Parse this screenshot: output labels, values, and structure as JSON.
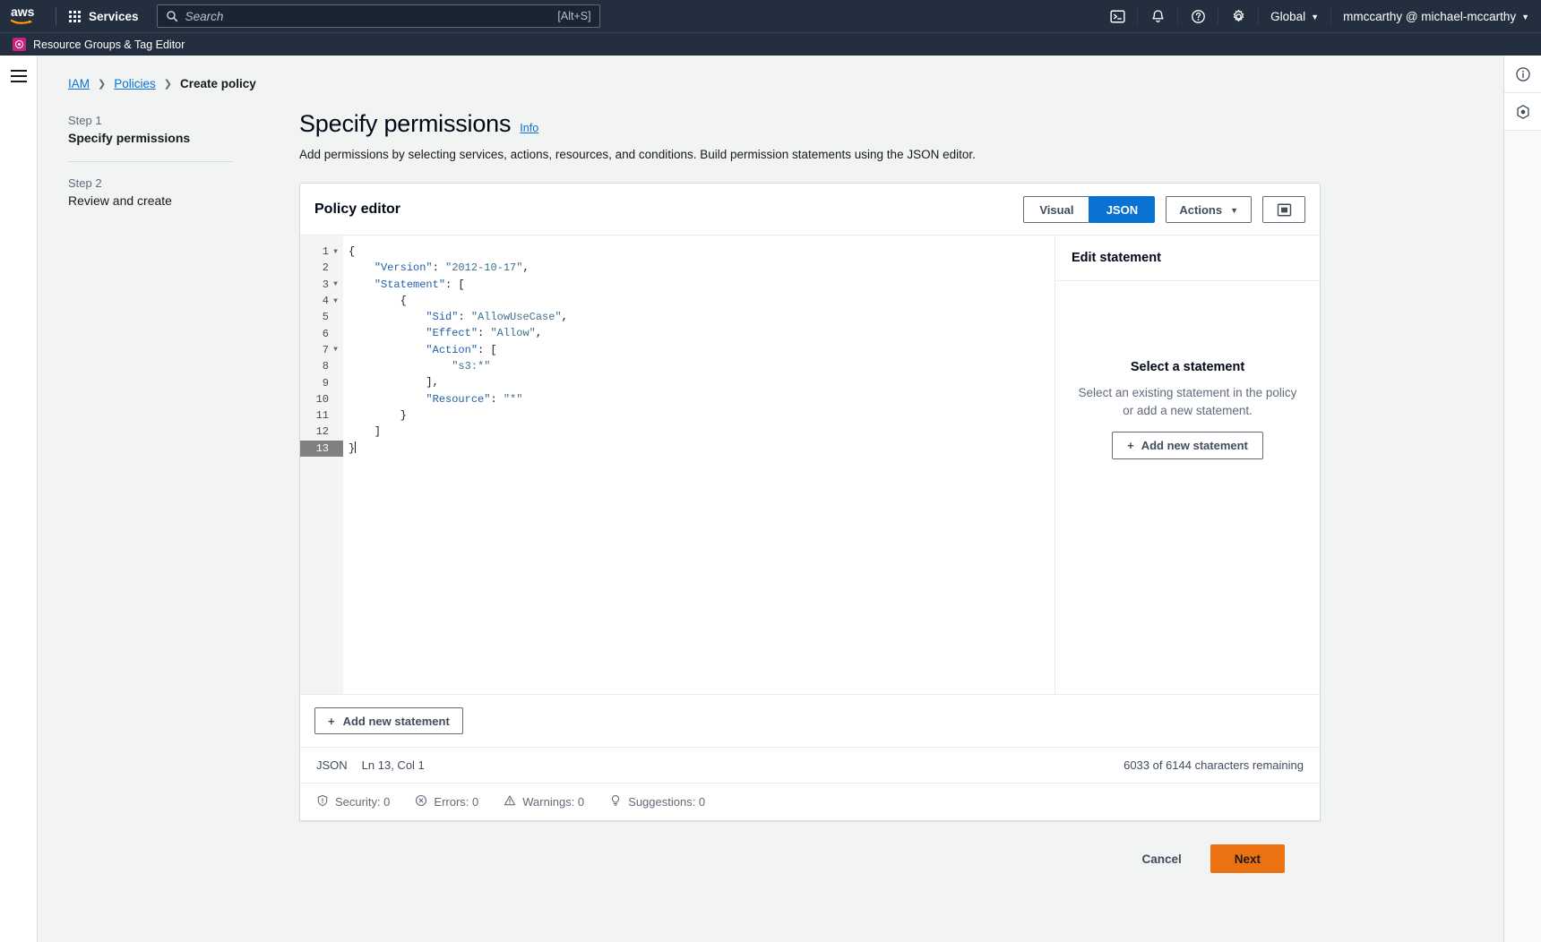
{
  "topnav": {
    "logo_alt": "aws",
    "services_label": "Services",
    "search_placeholder": "Search",
    "search_value": "",
    "search_shortcut": "[Alt+S]",
    "icons": [
      "cloudshell-icon",
      "notifications-icon",
      "help-icon",
      "settings-icon"
    ],
    "region_label": "Global",
    "account_label": "mmccarthy @ michael-mccarthy"
  },
  "subbar": {
    "label": "Resource Groups & Tag Editor"
  },
  "breadcrumb": {
    "items": [
      {
        "label": "IAM",
        "link": true
      },
      {
        "label": "Policies",
        "link": true
      },
      {
        "label": "Create policy",
        "link": false
      }
    ],
    "separator": "❯"
  },
  "steps": [
    {
      "num": "Step 1",
      "title": "Specify permissions",
      "active": true
    },
    {
      "num": "Step 2",
      "title": "Review and create",
      "active": false
    }
  ],
  "page": {
    "title": "Specify permissions",
    "info_label": "Info",
    "description": "Add permissions by selecting services, actions, resources, and conditions. Build permission statements using the JSON editor."
  },
  "editor_card": {
    "title": "Policy editor",
    "segmented": [
      {
        "label": "Visual",
        "active": false
      },
      {
        "label": "JSON",
        "active": true
      }
    ],
    "actions_label": "Actions",
    "actions_caret": "▼",
    "panel_toggle_name": "toggle-side-panel"
  },
  "code_lines": [
    {
      "num": "1",
      "fold": true,
      "current": false,
      "tokens": [
        {
          "t": "{",
          "c": "p"
        }
      ],
      "caret": false
    },
    {
      "num": "2",
      "fold": false,
      "current": false,
      "tokens": [
        {
          "t": "    ",
          "c": "p"
        },
        {
          "t": "\"Version\"",
          "c": "k"
        },
        {
          "t": ": ",
          "c": "p"
        },
        {
          "t": "\"2012-10-17\"",
          "c": "s"
        },
        {
          "t": ",",
          "c": "p"
        }
      ]
    },
    {
      "num": "3",
      "fold": true,
      "current": false,
      "tokens": [
        {
          "t": "    ",
          "c": "p"
        },
        {
          "t": "\"Statement\"",
          "c": "k"
        },
        {
          "t": ": [",
          "c": "p"
        }
      ]
    },
    {
      "num": "4",
      "fold": true,
      "current": false,
      "tokens": [
        {
          "t": "        {",
          "c": "p"
        }
      ]
    },
    {
      "num": "5",
      "fold": false,
      "current": false,
      "tokens": [
        {
          "t": "            ",
          "c": "p"
        },
        {
          "t": "\"Sid\"",
          "c": "k"
        },
        {
          "t": ": ",
          "c": "p"
        },
        {
          "t": "\"AllowUseCase\"",
          "c": "s"
        },
        {
          "t": ",",
          "c": "p"
        }
      ]
    },
    {
      "num": "6",
      "fold": false,
      "current": false,
      "tokens": [
        {
          "t": "            ",
          "c": "p"
        },
        {
          "t": "\"Effect\"",
          "c": "k"
        },
        {
          "t": ": ",
          "c": "p"
        },
        {
          "t": "\"Allow\"",
          "c": "s"
        },
        {
          "t": ",",
          "c": "p"
        }
      ]
    },
    {
      "num": "7",
      "fold": true,
      "current": false,
      "tokens": [
        {
          "t": "            ",
          "c": "p"
        },
        {
          "t": "\"Action\"",
          "c": "k"
        },
        {
          "t": ": [",
          "c": "p"
        }
      ]
    },
    {
      "num": "8",
      "fold": false,
      "current": false,
      "tokens": [
        {
          "t": "                ",
          "c": "p"
        },
        {
          "t": "\"s3:*\"",
          "c": "s"
        }
      ]
    },
    {
      "num": "9",
      "fold": false,
      "current": false,
      "tokens": [
        {
          "t": "            ],",
          "c": "p"
        }
      ]
    },
    {
      "num": "10",
      "fold": false,
      "current": false,
      "tokens": [
        {
          "t": "            ",
          "c": "p"
        },
        {
          "t": "\"Resource\"",
          "c": "k"
        },
        {
          "t": ": ",
          "c": "p"
        },
        {
          "t": "\"*\"",
          "c": "s"
        }
      ]
    },
    {
      "num": "11",
      "fold": false,
      "current": false,
      "tokens": [
        {
          "t": "        }",
          "c": "p"
        }
      ]
    },
    {
      "num": "12",
      "fold": false,
      "current": false,
      "tokens": [
        {
          "t": "    ]",
          "c": "p"
        }
      ]
    },
    {
      "num": "13",
      "fold": false,
      "current": true,
      "tokens": [
        {
          "t": "}",
          "c": "p"
        }
      ],
      "caret": true
    }
  ],
  "side_panel": {
    "header": "Edit statement",
    "empty_title": "Select a statement",
    "empty_desc": "Select an existing statement in the policy or add a new statement.",
    "add_label": "Add new statement",
    "add_plus": "+"
  },
  "add_statement_bar": {
    "label": "Add new statement",
    "plus": "+"
  },
  "statusbar": {
    "mode": "JSON",
    "position": "Ln 13, Col 1",
    "characters": "6033 of 6144 characters remaining"
  },
  "diagnostics": [
    {
      "icon": "security-icon",
      "label": "Security: 0"
    },
    {
      "icon": "errors-icon",
      "label": "Errors: 0"
    },
    {
      "icon": "warnings-icon",
      "label": "Warnings: 0"
    },
    {
      "icon": "suggestions-icon",
      "label": "Suggestions: 0"
    }
  ],
  "footer": {
    "cancel_label": "Cancel",
    "next_label": "Next"
  },
  "right_rail": {
    "items": [
      "info-panel-icon",
      "security-advisor-icon"
    ]
  },
  "colors": {
    "nav_bg": "#232f3e",
    "accent_blue": "#0972d3",
    "link_blue": "#0972d3",
    "primary_orange": "#ec7211",
    "page_bg": "#f2f3f3",
    "rg_pink": "#c7237f"
  }
}
